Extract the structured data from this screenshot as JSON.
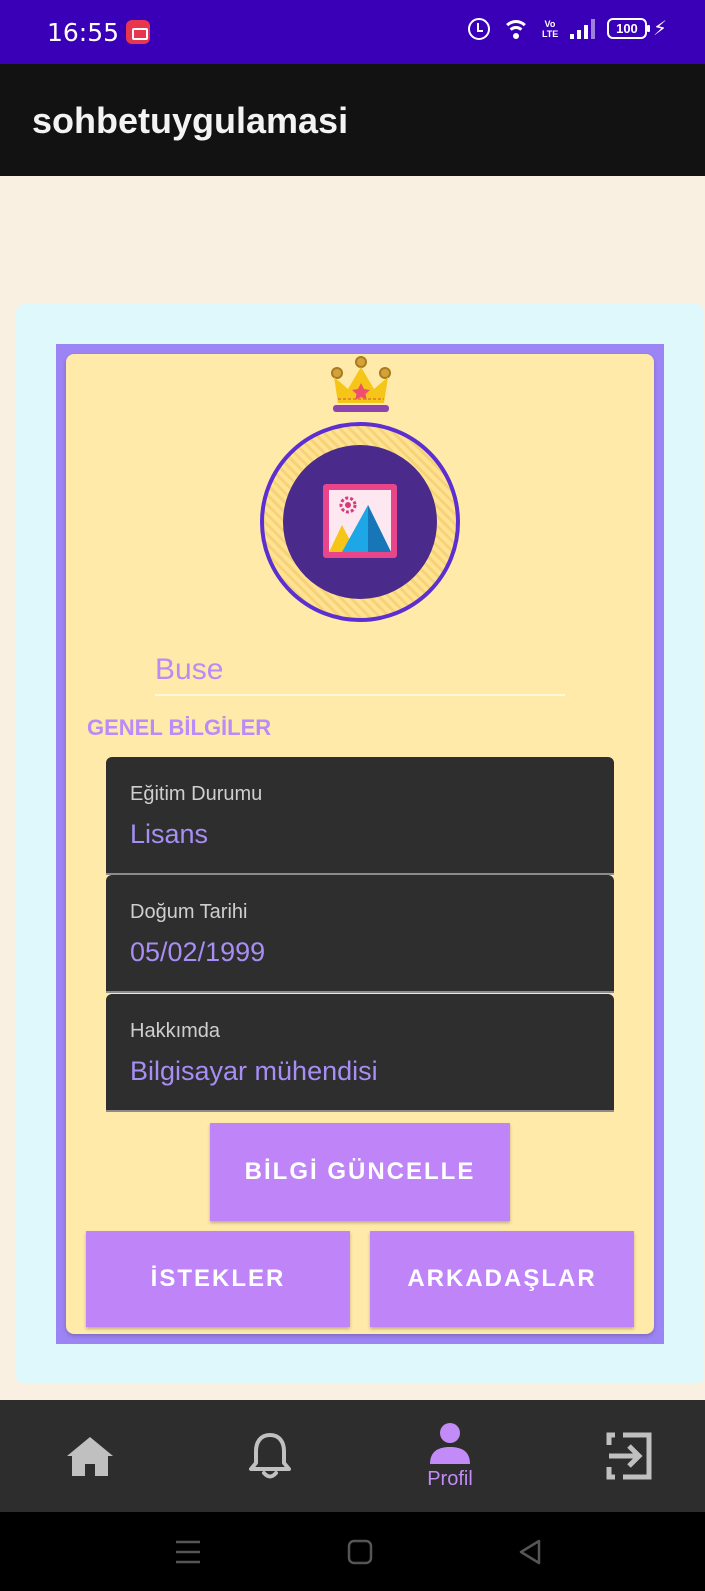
{
  "status_bar": {
    "time": "16:55",
    "volte": "Vo\nLTE",
    "battery": "100"
  },
  "app_bar": {
    "title": "sohbetuygulamasi"
  },
  "profile": {
    "name": "Buse",
    "section_title": "GENEL BİLGİLER",
    "fields": [
      {
        "label": "Eğitim Durumu",
        "value": "Lisans"
      },
      {
        "label": "Doğum Tarihi",
        "value": "05/02/1999"
      },
      {
        "label": "Hakkımda",
        "value": "Bilgisayar mühendisi"
      }
    ],
    "update_button": "BİLGİ GÜNCELLE",
    "requests_button": "İSTEKLER",
    "friends_button": "ARKADAŞLAR"
  },
  "bottom_nav": {
    "items": [
      {
        "icon": "home-icon"
      },
      {
        "icon": "bell-icon"
      },
      {
        "icon": "person-icon",
        "label": "Profil",
        "active": true
      },
      {
        "icon": "exit-icon"
      }
    ]
  },
  "colors": {
    "status_bar": "#3a00b8",
    "accent": "#bf84f8",
    "card": "#ffeaa9",
    "frame": "#9d84f4"
  }
}
